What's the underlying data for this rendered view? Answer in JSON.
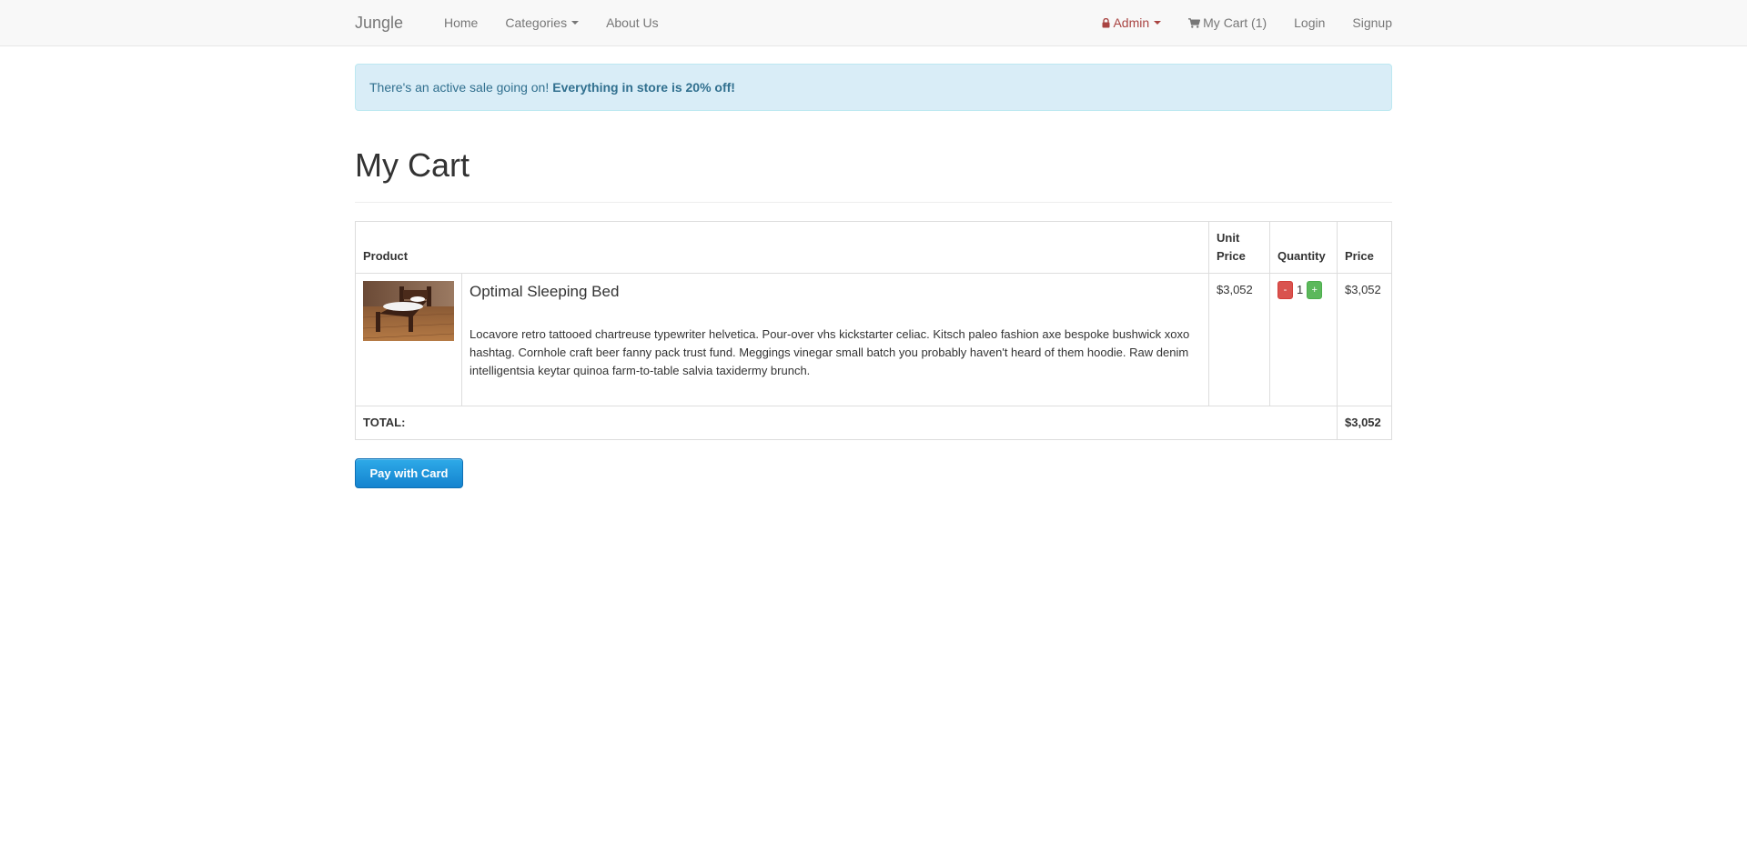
{
  "navbar": {
    "brand": "Jungle",
    "left_links": [
      {
        "label": "Home"
      },
      {
        "label": "Categories"
      },
      {
        "label": "About Us"
      }
    ],
    "right_links": [
      {
        "label": "Admin",
        "icon": "lock-icon"
      },
      {
        "label": "My Cart (1)",
        "icon": "cart-icon"
      },
      {
        "label": "Login"
      },
      {
        "label": "Signup"
      }
    ]
  },
  "alert": {
    "text": "There's an active sale going on!",
    "emphasis": "Everything in store is 20% off!"
  },
  "page": {
    "title": "My Cart"
  },
  "cart": {
    "headers": {
      "product": "Product",
      "unit_price": "Unit Price",
      "quantity": "Quantity",
      "price": "Price"
    },
    "items": [
      {
        "name": "Optimal Sleeping Bed",
        "description": "Locavore retro tattooed chartreuse typewriter helvetica. Pour-over vhs kickstarter celiac. Kitsch paleo fashion axe bespoke bushwick xoxo hashtag. Cornhole craft beer fanny pack trust fund. Meggings vinegar small batch you probably haven't heard of them hoodie. Raw denim intelligentsia keytar quinoa farm-to-table salvia taxidermy brunch.",
        "unit_price": "$3,052",
        "quantity": "1",
        "minus_label": "-",
        "plus_label": "+",
        "price": "$3,052"
      }
    ],
    "total_label": "TOTAL:",
    "total_value": "$3,052"
  },
  "checkout": {
    "pay_label": "Pay with Card"
  },
  "colors": {
    "navbar_bg": "#f8f8f8",
    "alert_bg": "#d9edf7",
    "alert_text": "#31708f",
    "admin_text": "#a94442",
    "btn_danger": "#d9534f",
    "btn_success": "#5cb85c",
    "pay_button": "#1a8fdc"
  }
}
